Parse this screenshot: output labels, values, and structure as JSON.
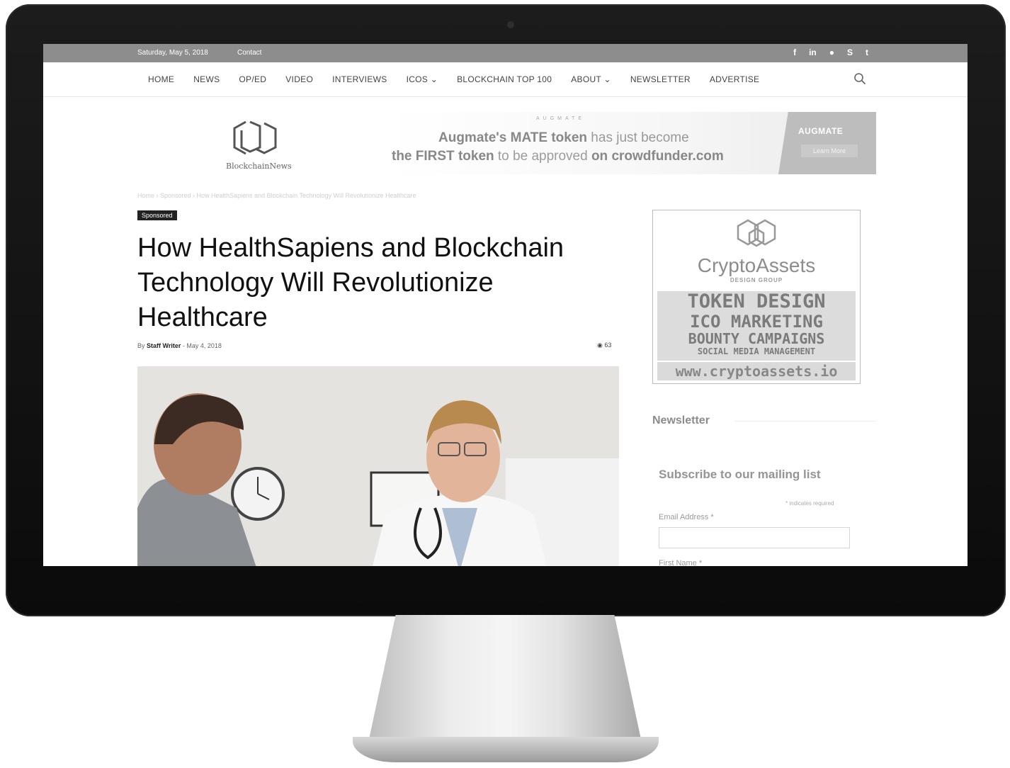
{
  "topbar": {
    "date": "Saturday, May 5, 2018",
    "contact": "Contact",
    "social_icons": [
      "facebook-icon",
      "linkedin-icon",
      "reddit-icon",
      "skype-icon",
      "twitter-icon"
    ],
    "social_glyphs": [
      "f",
      "in",
      "●",
      "S",
      "t"
    ]
  },
  "nav": {
    "items": [
      "HOME",
      "NEWS",
      "OP/ED",
      "VIDEO",
      "INTERVIEWS",
      "ICOS ⌄",
      "BLOCKCHAIN TOP 100",
      "ABOUT ⌄",
      "NEWSLETTER",
      "ADVERTISE"
    ]
  },
  "logo": {
    "text": "BlockchainNews"
  },
  "ad": {
    "tag": "AUGMATE",
    "line1_a": "Augmate's MATE token",
    "line1_b": " has just become",
    "line2_a": "the FIRST token",
    "line2_b": " to be approved ",
    "line2_c": "on crowdfunder.com",
    "brand": "AUGMATE",
    "cta": "Learn More"
  },
  "breadcrumb": "Home  ›  Sponsored  ›  How HealthSapiens and Blockchain Technology Will Revolutionize Healthcare",
  "article": {
    "category": "Sponsored",
    "title": "How HealthSapiens and Blockchain Technology Will Revolutionize Healthcare",
    "by": "By",
    "author": "Staff Writer",
    "date": "May 4, 2018",
    "views": "63"
  },
  "sidebar_ad": {
    "name": "CryptoAssets",
    "sub": "DESIGN GROUP",
    "line1": "TOKEN DESIGN",
    "line2": "ICO MARKETING",
    "line3": "BOUNTY CAMPAIGNS",
    "line4": "SOCIAL MEDIA MANAGEMENT",
    "url": "www.cryptoassets.io"
  },
  "newsletter": {
    "title": "Newsletter",
    "subscribe": "Subscribe to our mailing list",
    "required": "* indicates required",
    "email_label": "Email Address *",
    "fname_label": "First Name *"
  }
}
